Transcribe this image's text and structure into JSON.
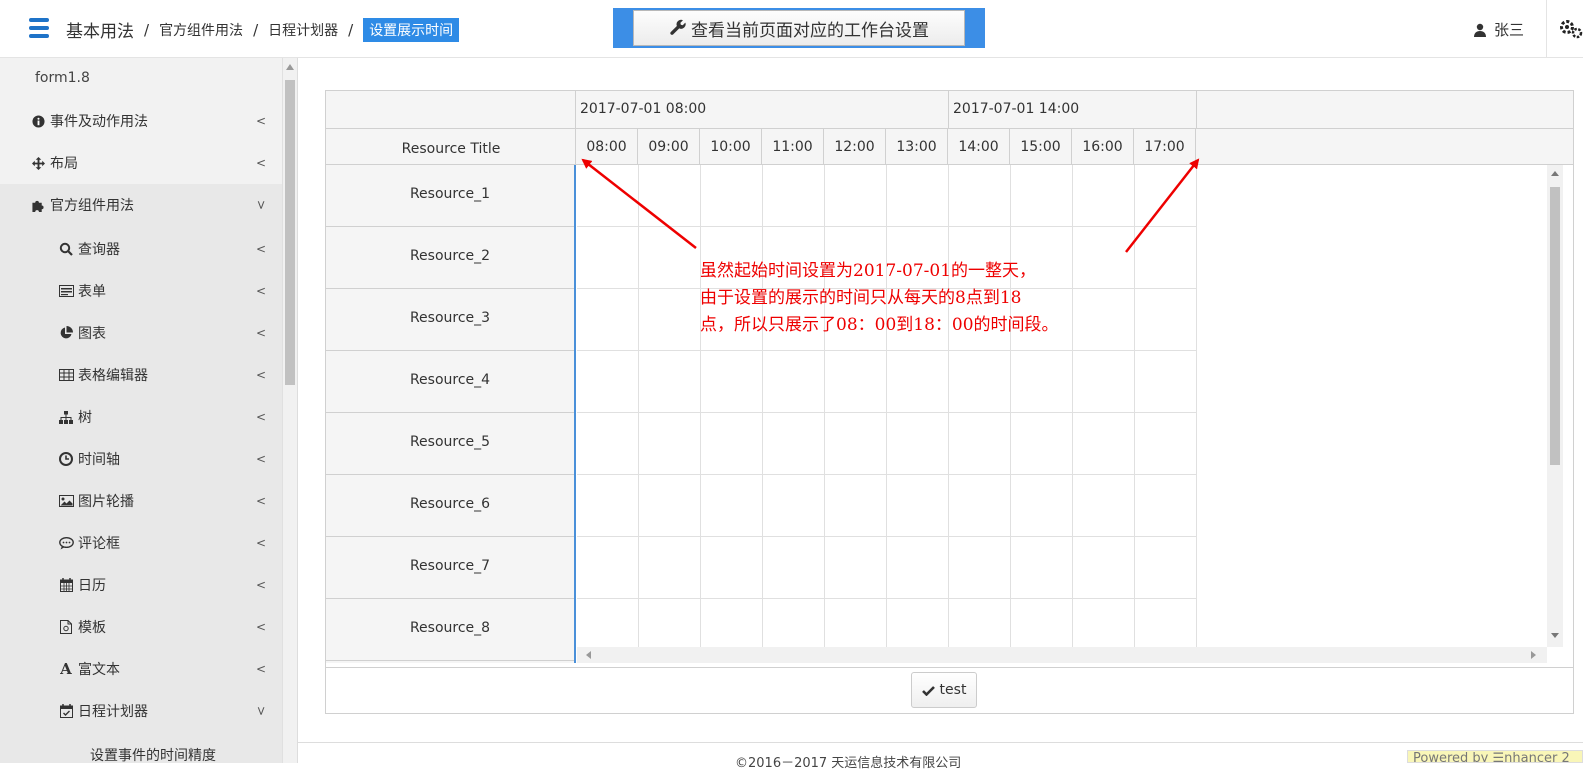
{
  "header": {
    "app_title": "基本用法",
    "breadcrumbs": [
      "官方组件用法",
      "日程计划器"
    ],
    "active_crumb": "设置展示时间",
    "workspace_button": "查看当前页面对应的工作台设置",
    "user_name": "张三"
  },
  "sidebar": {
    "version": "form1.8",
    "top_items": [
      {
        "label": "事件及动作用法",
        "icon": "info-circle-icon"
      },
      {
        "label": "布局",
        "icon": "move-arrows-icon"
      },
      {
        "label": "官方组件用法",
        "icon": "puzzle-icon"
      }
    ],
    "sub_items": [
      {
        "label": "查询器",
        "icon": "search-icon"
      },
      {
        "label": "表单",
        "icon": "form-icon"
      },
      {
        "label": "图表",
        "icon": "pie-chart-icon"
      },
      {
        "label": "表格编辑器",
        "icon": "table-icon"
      },
      {
        "label": "树",
        "icon": "sitemap-icon"
      },
      {
        "label": "时间轴",
        "icon": "clock-icon"
      },
      {
        "label": "图片轮播",
        "icon": "image-icon"
      },
      {
        "label": "评论框",
        "icon": "comment-icon"
      },
      {
        "label": "日历",
        "icon": "calendar-icon"
      },
      {
        "label": "模板",
        "icon": "template-icon"
      },
      {
        "label": "富文本",
        "icon": "font-icon"
      },
      {
        "label": "日程计划器",
        "icon": "calendar-check-icon"
      }
    ],
    "cut_item": "设置事件的时间精度"
  },
  "scheduler": {
    "resource_header": "Resource Title",
    "date_headers": [
      "2017-07-01 08:00",
      "2017-07-01 14:00"
    ],
    "hours": [
      "08:00",
      "09:00",
      "10:00",
      "11:00",
      "12:00",
      "13:00",
      "14:00",
      "15:00",
      "16:00",
      "17:00"
    ],
    "resources": [
      "Resource_1",
      "Resource_2",
      "Resource_3",
      "Resource_4",
      "Resource_5",
      "Resource_6",
      "Resource_7",
      "Resource_8"
    ],
    "test_button": "test"
  },
  "annotation": {
    "lines": [
      "虽然起始时间设置为2017-07-01的一整天，",
      "由于设置的展示的时间只从每天的8点到18",
      "点，所以只展示了08：00到18：00的时间段。"
    ]
  },
  "footer": {
    "copyright": "©2016－2017 天运信息技术有限公司",
    "powered": "Powered by ☰nhancer 2"
  }
}
